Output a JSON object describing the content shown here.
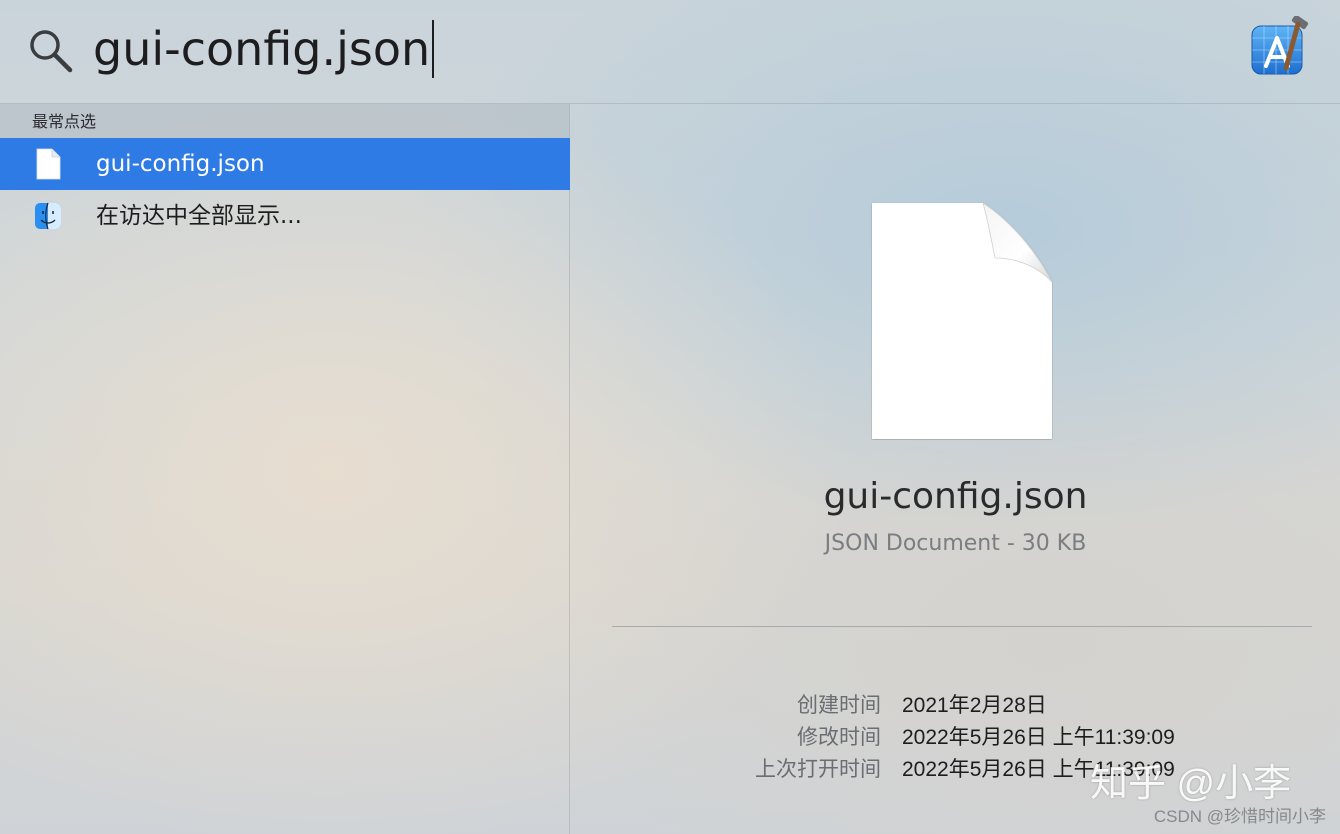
{
  "search": {
    "query": "gui-config.json",
    "icon": "magnifier-icon",
    "app_icon": "xcode-icon"
  },
  "results": {
    "section_title": "最常点选",
    "items": [
      {
        "label": "gui-config.json",
        "icon": "json-file-icon",
        "selected": true
      },
      {
        "label": "在访达中全部显示...",
        "icon": "finder-icon",
        "selected": false
      }
    ]
  },
  "preview": {
    "file_name": "gui-config.json",
    "file_kind": "JSON Document - 30 KB",
    "metadata": [
      {
        "label": "创建时间",
        "value": "2021年2月28日"
      },
      {
        "label": "修改时间",
        "value": "2022年5月26日 上午11:39:09"
      },
      {
        "label": "上次打开时间",
        "value": "2022年5月26日 上午11:39:09"
      }
    ]
  },
  "watermarks": {
    "zhihu": "知乎 @小李",
    "csdn": "CSDN @珍惜时间小李"
  },
  "colors": {
    "selection": "#2f7be5"
  }
}
